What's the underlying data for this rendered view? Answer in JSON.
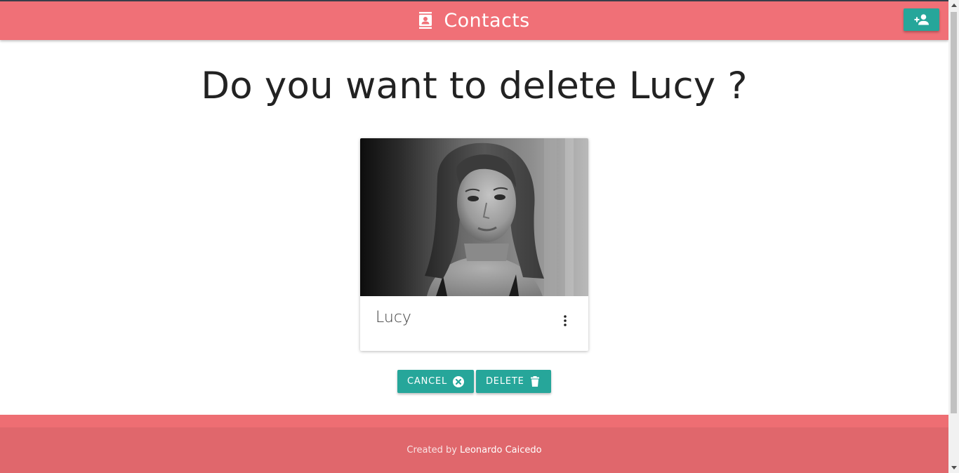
{
  "navbar": {
    "title": "Contacts",
    "brand_icon": "contacts-icon",
    "add_button_icon": "person-add-icon",
    "color": "#f07077"
  },
  "page": {
    "heading": "Do you want to delete Lucy ?"
  },
  "card": {
    "name": "Lucy",
    "photo_alt": "Lucy",
    "menu_icon": "more-vert-icon"
  },
  "actions": {
    "cancel_label": "CANCEL",
    "cancel_icon": "cancel-circle-icon",
    "delete_label": "DELETE",
    "delete_icon": "trash-icon",
    "button_color": "#26a69a"
  },
  "footer": {
    "prefix": "Created by",
    "author": "Leonardo Caicedo",
    "color": "#e0676c"
  }
}
